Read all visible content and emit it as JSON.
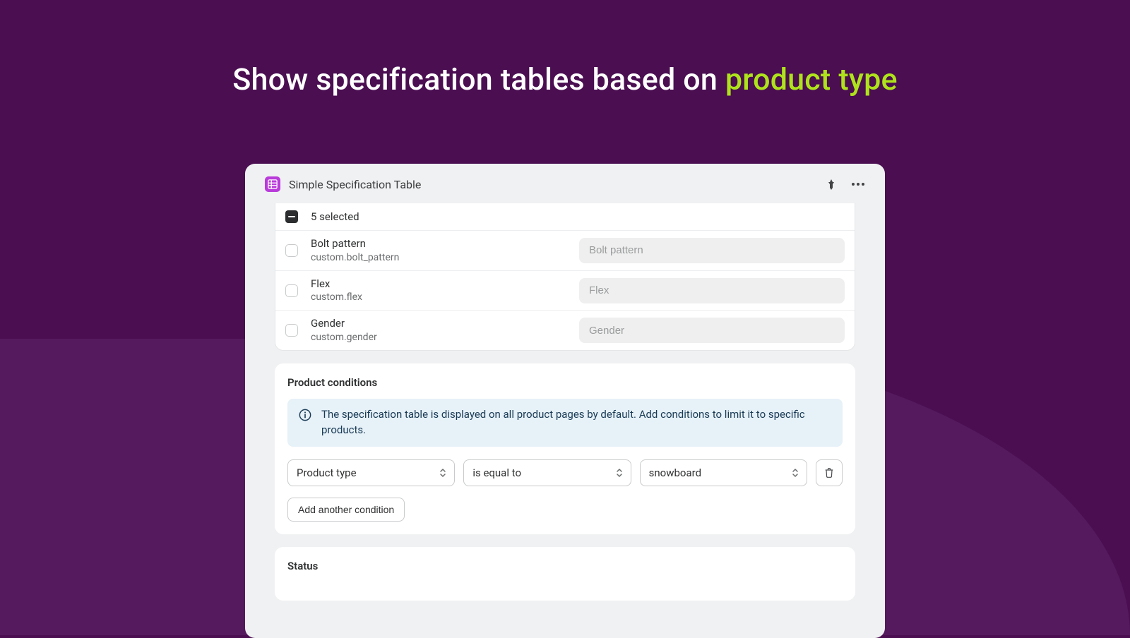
{
  "headline": {
    "prefix": "Show specification tables based on ",
    "accent": "product type"
  },
  "header": {
    "title": "Simple Specification Table"
  },
  "selection": {
    "count_label": "5 selected"
  },
  "rows": [
    {
      "name": "Bolt pattern",
      "key": "custom.bolt_pattern",
      "placeholder": "Bolt pattern"
    },
    {
      "name": "Flex",
      "key": "custom.flex",
      "placeholder": "Flex"
    },
    {
      "name": "Gender",
      "key": "custom.gender",
      "placeholder": "Gender"
    }
  ],
  "conditions": {
    "title": "Product conditions",
    "info": "The specification table is displayed on all product pages by default. Add conditions to limit it to specific products.",
    "field": "Product type",
    "operator": "is equal to",
    "value": "snowboard",
    "add_label": "Add another condition"
  },
  "status": {
    "title": "Status"
  }
}
